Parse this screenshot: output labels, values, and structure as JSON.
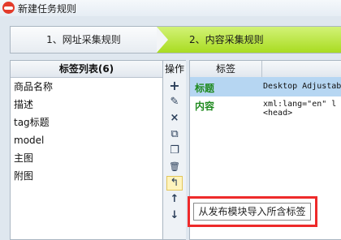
{
  "window": {
    "title": "新建任务规则"
  },
  "wizard": {
    "steps": [
      {
        "label": "1、网址采集规则",
        "active": false
      },
      {
        "label": "2、内容采集规则",
        "active": true
      }
    ],
    "active_color": "#b9e34a"
  },
  "tag_list": {
    "header": "标签列表(6)",
    "items": [
      "商品名称",
      "描述",
      "tag标题",
      "model",
      "主图",
      "附图"
    ]
  },
  "operations": {
    "header": "操作",
    "icons": [
      "plus-icon",
      "edit-icon",
      "delete-icon",
      "copy-icon",
      "paste-icon",
      "trash-icon",
      "import-icon",
      "move-up-icon",
      "move-down-icon"
    ]
  },
  "tag_grid": {
    "column_header": "标签",
    "rows": [
      {
        "name": "标题",
        "content": "Desktop Adjustab",
        "selected": true
      },
      {
        "name": "内容",
        "content": "xml:lang=\"en\" l\n<head>",
        "selected": false
      }
    ]
  },
  "tooltip": {
    "text": "从发布模块导入所含标签"
  },
  "colors": {
    "tag_name": "#1f8a1f",
    "selected_row": "#b6d6f2",
    "highlight": "#ee2a2a"
  }
}
